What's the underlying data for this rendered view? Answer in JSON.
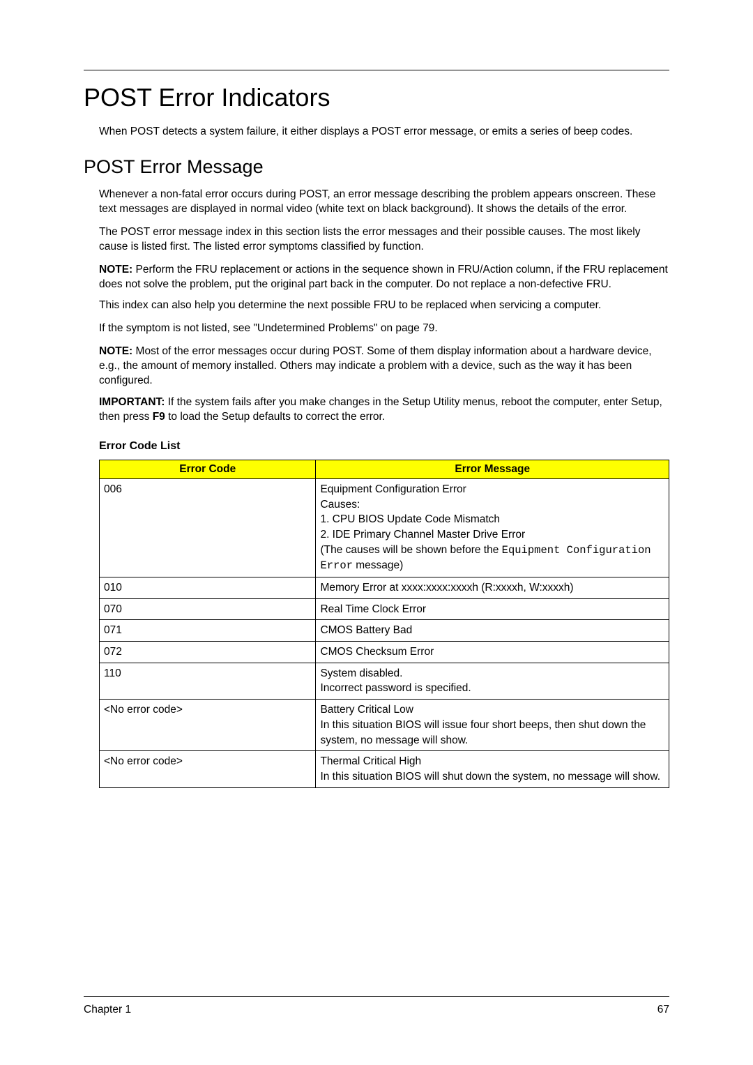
{
  "page_title": "POST Error Indicators",
  "intro": "When POST detects a system failure, it either displays a POST error message, or emits a series of beep codes.",
  "sub_heading": "POST Error Message",
  "para1": "Whenever a non-fatal error occurs during POST, an error message describing the problem appears onscreen. These text messages are displayed in normal video (white text on black background). It shows the details of the error.",
  "para2": "The POST error message index in this section lists the error messages and their possible causes. The most likely cause is listed first. The listed error symptoms classified by function.",
  "note1_label": "NOTE:",
  "note1_body": "Perform the FRU replacement or actions in the sequence shown in FRU/Action column, if the FRU replacement does not solve the problem, put the original part back in the computer. Do not replace a non-defective FRU.",
  "para3": "This index can also help you determine the next possible FRU to be replaced when servicing a computer.",
  "para4": "If the symptom is not listed, see \"Undetermined Problems\" on page 79.",
  "note2_label": "NOTE:",
  "note2_body": "Most of the error messages occur during POST. Some of them display information about a hardware device, e.g., the amount of memory installed. Others may indicate a problem with a device, such as the way it has been configured.",
  "important_label": "IMPORTANT:",
  "important_body_a": "If the system fails after you make changes in the Setup Utility menus, reboot the computer, enter Setup, then press ",
  "important_key": "F9",
  "important_body_b": " to load the Setup defaults to correct the error.",
  "table_title": "Error Code List",
  "table_headers": {
    "code": "Error Code",
    "message": "Error Message"
  },
  "rows": {
    "r0_code": "006",
    "r0_line1": "Equipment Configuration Error",
    "r0_line2": "Causes:",
    "r0_line3": "1. CPU BIOS Update Code Mismatch",
    "r0_line4": "2. IDE Primary Channel Master Drive Error",
    "r0_line5a": "(The causes will be shown before the ",
    "r0_mono": "Equipment Configuration Error",
    "r0_line5b": " message)",
    "r1_code": "010",
    "r1_msg": "Memory Error at xxxx:xxxx:xxxxh (R:xxxxh, W:xxxxh)",
    "r2_code": "070",
    "r2_msg": "Real Time Clock Error",
    "r3_code": "071",
    "r3_msg": "CMOS Battery Bad",
    "r4_code": "072",
    "r4_msg": "CMOS Checksum Error",
    "r5_code": "110",
    "r5_line1": "System disabled.",
    "r5_line2": "Incorrect password is specified.",
    "r6_code": "<No error code>",
    "r6_line1": "Battery Critical Low",
    "r6_line2": "In this situation BIOS will issue four short beeps, then shut down the system, no message will show.",
    "r7_code": "<No error code>",
    "r7_line1": "Thermal Critical High",
    "r7_line2": "In this situation BIOS will shut down the system, no message will show."
  },
  "footer_left": "Chapter 1",
  "footer_right": "67"
}
